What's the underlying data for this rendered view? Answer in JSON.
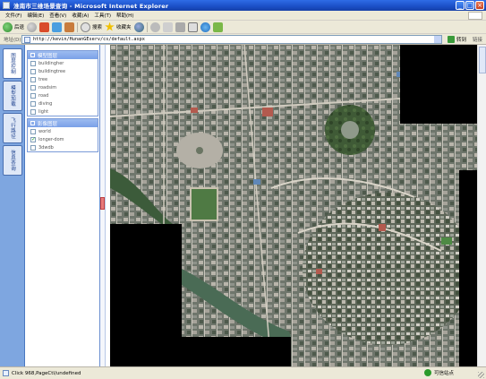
{
  "window": {
    "title": "淮南市三维场景查询 - Microsoft Internet Explorer"
  },
  "menu": {
    "items": [
      "文件(F)",
      "编辑(E)",
      "查看(V)",
      "收藏(A)",
      "工具(T)",
      "帮助(H)"
    ]
  },
  "toolbar": {
    "back_label": "后退",
    "search_label": "搜索",
    "favorites_label": "收藏夹"
  },
  "address": {
    "label": "地址(D)",
    "url": "http://kevin/HunanGEserv/cs/default.aspx",
    "go_label": "转到",
    "links_label": "链接"
  },
  "tabs": [
    {
      "label": "图层控制"
    },
    {
      "label": "模型加载"
    },
    {
      "label": "飞行路径"
    },
    {
      "label": "信息查询"
    }
  ],
  "layers": {
    "model_group_title": "模型图层",
    "model_layers": [
      {
        "label": "buildingher",
        "checked": false
      },
      {
        "label": "buildingtree",
        "checked": false
      },
      {
        "label": "tree",
        "checked": false
      },
      {
        "label": "roadsim",
        "checked": false
      },
      {
        "label": "road",
        "checked": false
      },
      {
        "label": "diving",
        "checked": false
      },
      {
        "label": "light",
        "checked": false
      }
    ],
    "image_group_title": "影像图层",
    "image_layers": [
      {
        "label": "world",
        "checked": false
      },
      {
        "label": "longer-dom",
        "checked": true
      },
      {
        "label": "3dwdb",
        "checked": false
      }
    ]
  },
  "status": {
    "text": "Click 968,PageCtl/undefined",
    "zone": "可信站点"
  },
  "colors": {
    "titlebar": "#1b4fc7",
    "panel_border": "#7a9ad8",
    "chrome": "#ece9d8"
  }
}
